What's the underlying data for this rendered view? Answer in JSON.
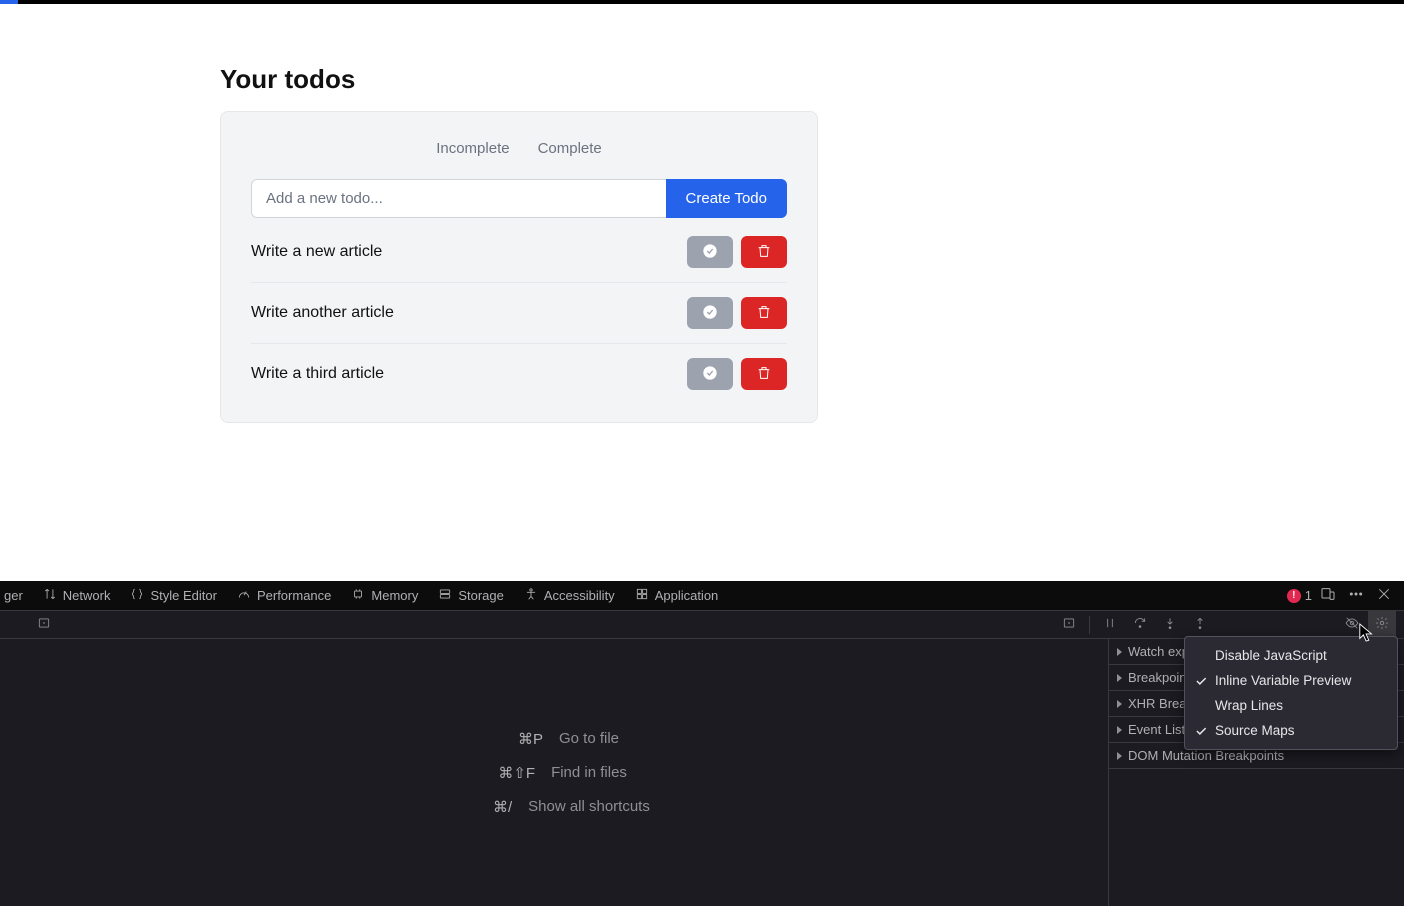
{
  "page": {
    "title": "Your todos"
  },
  "tabs": {
    "incomplete": "Incomplete",
    "complete": "Complete"
  },
  "input": {
    "placeholder": "Add a new todo...",
    "create_label": "Create Todo",
    "value": ""
  },
  "todos": [
    {
      "text": "Write a new article"
    },
    {
      "text": "Write another article"
    },
    {
      "text": "Write a third article"
    }
  ],
  "devtools": {
    "tabs": {
      "debugger_partial": "ger",
      "network": "Network",
      "style_editor": "Style Editor",
      "performance": "Performance",
      "memory": "Memory",
      "storage": "Storage",
      "accessibility": "Accessibility",
      "application": "Application"
    },
    "errors": "1",
    "shortcuts": {
      "goto_key": "⌘P",
      "goto_label": "Go to file",
      "find_key": "⌘⇧F",
      "find_label": "Find in files",
      "all_key": "⌘/",
      "all_label": "Show all shortcuts"
    },
    "right_panel": {
      "watch": "Watch expressi",
      "breakpoints": "Breakpoints",
      "xhr": "XHR Breakpoint",
      "event": "Event Listener B",
      "dom": "DOM Mutation Breakpoints"
    },
    "settings_menu": {
      "disable_js": "Disable JavaScript",
      "inline_preview": "Inline Variable Preview",
      "wrap_lines": "Wrap Lines",
      "source_maps": "Source Maps"
    }
  }
}
